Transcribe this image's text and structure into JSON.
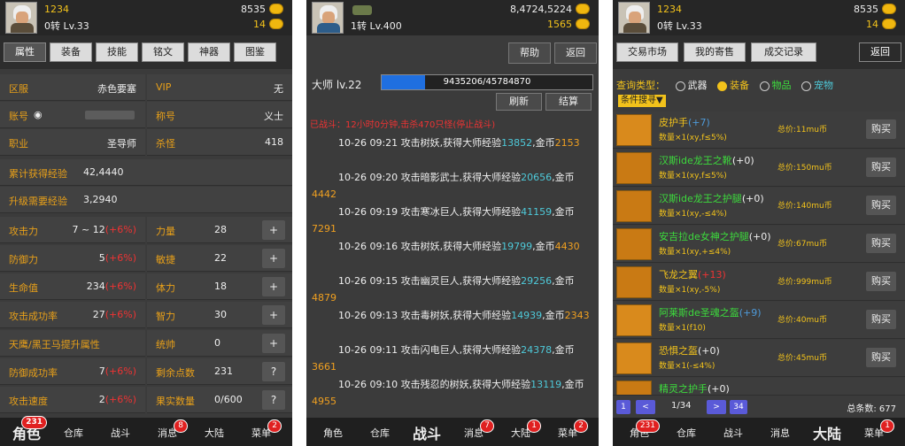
{
  "p1": {
    "header": {
      "name": "1234",
      "level": "0转 Lv.33",
      "gold": "8535",
      "gem": "14"
    },
    "tabs": [
      "属性",
      "装备",
      "技能",
      "铭文",
      "神器",
      "图鉴"
    ],
    "info": [
      {
        "label": "区服",
        "value": "赤色要塞"
      },
      {
        "label": "VIP",
        "value": "无"
      },
      {
        "label": "账号",
        "value": ""
      },
      {
        "label": "称号",
        "value": "义士"
      },
      {
        "label": "职业",
        "value": "圣导师"
      },
      {
        "label": "杀怪",
        "value": "418"
      }
    ],
    "wide": [
      {
        "label": "累计获得经验",
        "value": "42,4440"
      },
      {
        "label": "升级需要经验",
        "value": "3,2940"
      }
    ],
    "stats": [
      {
        "label": "攻击力",
        "value": "7 ~ 12",
        "bonus": "(+6%)",
        "label2": "力量",
        "value2": "28",
        "btn": "+"
      },
      {
        "label": "防御力",
        "value": "5",
        "bonus": "(+6%)",
        "label2": "敏捷",
        "value2": "22",
        "btn": "+"
      },
      {
        "label": "生命值",
        "value": "234",
        "bonus": "(+6%)",
        "label2": "体力",
        "value2": "18",
        "btn": "+"
      },
      {
        "label": "攻击成功率",
        "value": "27",
        "bonus": "(+6%)",
        "label2": "智力",
        "value2": "30",
        "btn": "+"
      },
      {
        "label": "天鹰/黑王马提升属性",
        "value": "",
        "bonus": "",
        "label2": "统帅",
        "value2": "0",
        "btn": "+"
      },
      {
        "label": "防御成功率",
        "value": "7",
        "bonus": "(+6%)",
        "label2": "剩余点数",
        "value2": "231",
        "btn": "?"
      },
      {
        "label": "攻击速度",
        "value": "2",
        "bonus": "(+6%)",
        "label2": "果实数量",
        "value2": "0/600",
        "btn": "?"
      }
    ],
    "nav": [
      {
        "label": "角色",
        "badge": "231"
      },
      {
        "label": "仓库",
        "badge": ""
      },
      {
        "label": "战斗",
        "badge": ""
      },
      {
        "label": "消息",
        "badge": "8"
      },
      {
        "label": "大陆",
        "badge": ""
      },
      {
        "label": "菜单",
        "badge": "2"
      }
    ]
  },
  "p2": {
    "header": {
      "level": "1转 Lv.400",
      "gold": "8,4724,5224",
      "gem": "1565"
    },
    "buttons": {
      "help": "帮助",
      "back": "返回",
      "refresh": "刷新",
      "settle": "结算"
    },
    "master_level": "大师 lv.22",
    "exp_bar": {
      "text": "9435206/45784870",
      "progress": 0.206
    },
    "notice": "已战斗：12小时0分钟,击杀470只怪(停止战斗)",
    "log": [
      {
        "text": "10-26 09:21 攻击树妖,获得大师经验",
        "exp": "13852",
        "mid": ",金币",
        "gold": "2153"
      },
      {
        "text": "10-26 09:20 攻击暗影武士,获得大师经验",
        "exp": "20656",
        "mid": ",金币",
        "gold": "4442"
      },
      {
        "text": "10-26 09:19 攻击寒冰巨人,获得大师经验",
        "exp": "41159",
        "mid": ",金币",
        "gold": "7291"
      },
      {
        "text": "10-26 09:16 攻击树妖,获得大师经验",
        "exp": "19799",
        "mid": ",金币",
        "gold": "4430"
      },
      {
        "text": "10-26 09:15 攻击幽灵巨人,获得大师经验",
        "exp": "29256",
        "mid": ",金币",
        "gold": "4879"
      },
      {
        "text": "10-26 09:13 攻击毒树妖,获得大师经验",
        "exp": "14939",
        "mid": ",金币",
        "gold": "2343"
      },
      {
        "text": "10-26 09:11 攻击闪电巨人,获得大师经验",
        "exp": "24378",
        "mid": ",金币",
        "gold": "3661"
      },
      {
        "text": "10-26 09:10 攻击残忍的树妖,获得大师经验",
        "exp": "13119",
        "mid": ",金币",
        "gold": "4955"
      }
    ],
    "nav": [
      {
        "label": "角色",
        "badge": ""
      },
      {
        "label": "仓库",
        "badge": ""
      },
      {
        "label": "战斗",
        "badge": ""
      },
      {
        "label": "消息",
        "badge": "7"
      },
      {
        "label": "大陆",
        "badge": "1"
      },
      {
        "label": "菜单",
        "badge": "2"
      }
    ]
  },
  "p3": {
    "header": {
      "name": "1234",
      "level": "0转 Lv.33",
      "gold": "8535",
      "gem": "14"
    },
    "tabs": [
      "交易市场",
      "我的寄售",
      "成交记录"
    ],
    "back": "返回",
    "query_label": "查询类型：",
    "types": [
      "武器",
      "装备",
      "物品",
      "宠物"
    ],
    "filter": "条件搜寻▼",
    "items": [
      {
        "name": "皮护手",
        "plus": "(+7)",
        "qty": "数量×1(xy,f≤5%)",
        "price": "总价:11mu币",
        "color": "#f2c21b",
        "plusColor": "#4e9ad9"
      },
      {
        "name": "汉斯ide龙王之靴",
        "plus": "(+0)",
        "qty": "数量×1(xy,f≤5%)",
        "price": "总价:150mu币",
        "color": "#3ddc3d",
        "plusColor": "#eee"
      },
      {
        "name": "汉斯ide龙王之护腿",
        "plus": "(+0)",
        "qty": "数量×1(xy,-≤4%)",
        "price": "总价:140mu币",
        "color": "#3ddc3d",
        "plusColor": "#eee"
      },
      {
        "name": "安吉拉de女神之护腿",
        "plus": "(+0)",
        "qty": "数量×1(xy,+≤4%)",
        "price": "总价:67mu币",
        "color": "#3ddc3d",
        "plusColor": "#eee"
      },
      {
        "name": "飞龙之翼",
        "plus": "(+13)",
        "qty": "数量×1(xy,-5%)",
        "price": "总价:999mu币",
        "color": "#f2c21b",
        "plusColor": "#e33"
      },
      {
        "name": "阿莱斯de圣魂之盔",
        "plus": "(+9)",
        "qty": "数量×1(f10)",
        "price": "总价:40mu币",
        "color": "#3ddc3d",
        "plusColor": "#4e9ad9"
      },
      {
        "name": "恐惧之盔",
        "plus": "(+0)",
        "qty": "数量×1(-≤4%)",
        "price": "总价:45mu币",
        "color": "#f2c21b",
        "plusColor": "#eee"
      },
      {
        "name": "精灵之护手",
        "plus": "(+0)",
        "qty": "",
        "price": "",
        "color": "#3ddc3d",
        "plusColor": "#eee"
      }
    ],
    "buy": "购买",
    "pager": {
      "first": "1",
      "prev": "<",
      "page": "1/34",
      "next": ">",
      "last": "34",
      "total_label": "总条数:",
      "total": "677"
    },
    "nav": [
      {
        "label": "角色",
        "badge": "231"
      },
      {
        "label": "仓库",
        "badge": ""
      },
      {
        "label": "战斗",
        "badge": ""
      },
      {
        "label": "消息",
        "badge": ""
      },
      {
        "label": "大陆",
        "badge": ""
      },
      {
        "label": "菜单",
        "badge": "1"
      }
    ],
    "colors": {
      "accent": "#f2c21b",
      "green": "#3ddc3d",
      "red": "#e33"
    }
  }
}
